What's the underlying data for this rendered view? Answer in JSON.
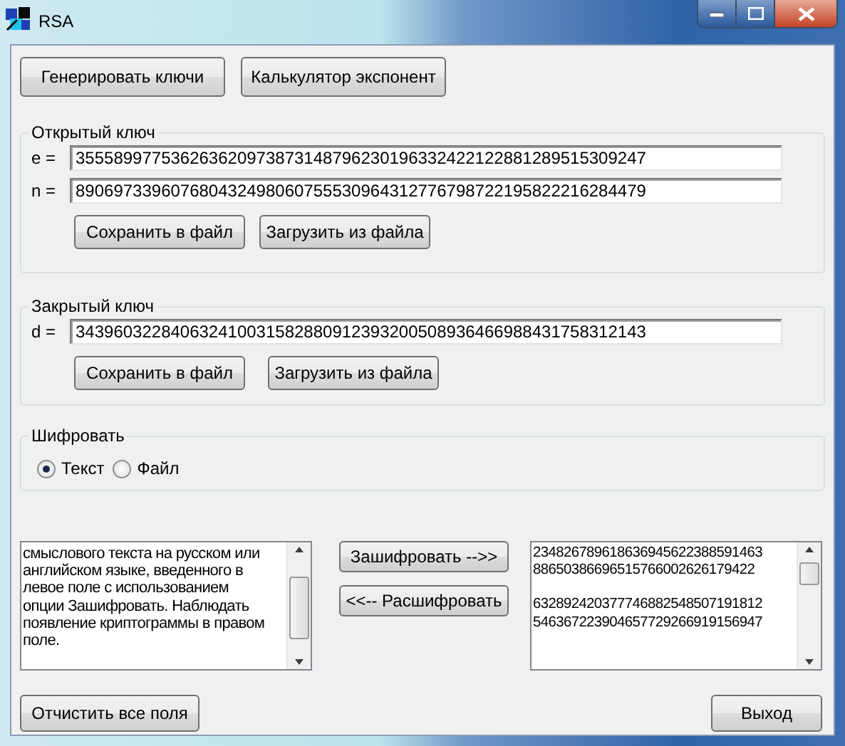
{
  "window": {
    "title": "RSA"
  },
  "top_buttons": [
    "Генерировать ключи",
    "Калькулятор экспонент"
  ],
  "public_key": {
    "title": "Открытый ключ",
    "fields": [
      {
        "label": "e =",
        "value": "355589977536263620973873148796230196332422122881289515309247"
      },
      {
        "label": "n =",
        "value": "890697339607680432498060755530964312776798722195822216284479"
      }
    ],
    "buttons": [
      "Сохранить в файл",
      "Загрузить из файла"
    ]
  },
  "private_key": {
    "title": "Закрытый ключ",
    "fields": [
      {
        "label": "d =",
        "value": "343960322840632410031582880912393200508936466988431758312143"
      }
    ],
    "buttons": [
      "Сохранить в файл",
      "Загрузить из файла"
    ]
  },
  "encrypt": {
    "title": "Шифровать",
    "options": [
      {
        "label": "Текст",
        "selected": true
      },
      {
        "label": "Файл",
        "selected": false
      }
    ]
  },
  "plaintext": {
    "lines": [
      "смыслового текста на русском или",
      "английском языке, введенного в",
      "левое поле с использованием",
      "опции Зашифровать. Наблюдать",
      "появление криптограммы в правом",
      "поле."
    ]
  },
  "actions": [
    "Зашифровать -->>",
    "<<-- Расшифровать"
  ],
  "ciphertext": {
    "blocks": [
      [
        "234826789618636945622388591463",
        "88650386696515766002626179422"
      ],
      [
        "632892420377746882548507191812",
        "546367223904657729266919156947"
      ]
    ]
  },
  "bottom_buttons": [
    "Отчистить все поля",
    "Выход"
  ]
}
